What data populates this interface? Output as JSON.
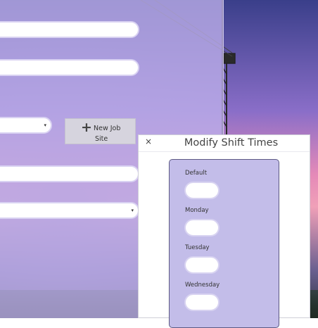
{
  "add_job_site": {
    "icon": "plus-icon",
    "label_line1": "New Job",
    "label_line2": "Site"
  },
  "modal": {
    "close_glyph": "×",
    "title": "Modify Shift Times",
    "days": [
      {
        "label": "Default",
        "value": ""
      },
      {
        "label": "Monday",
        "value": ""
      },
      {
        "label": "Tuesday",
        "value": ""
      },
      {
        "label": "Wednesday",
        "value": ""
      }
    ]
  },
  "select_arrow": "▾"
}
